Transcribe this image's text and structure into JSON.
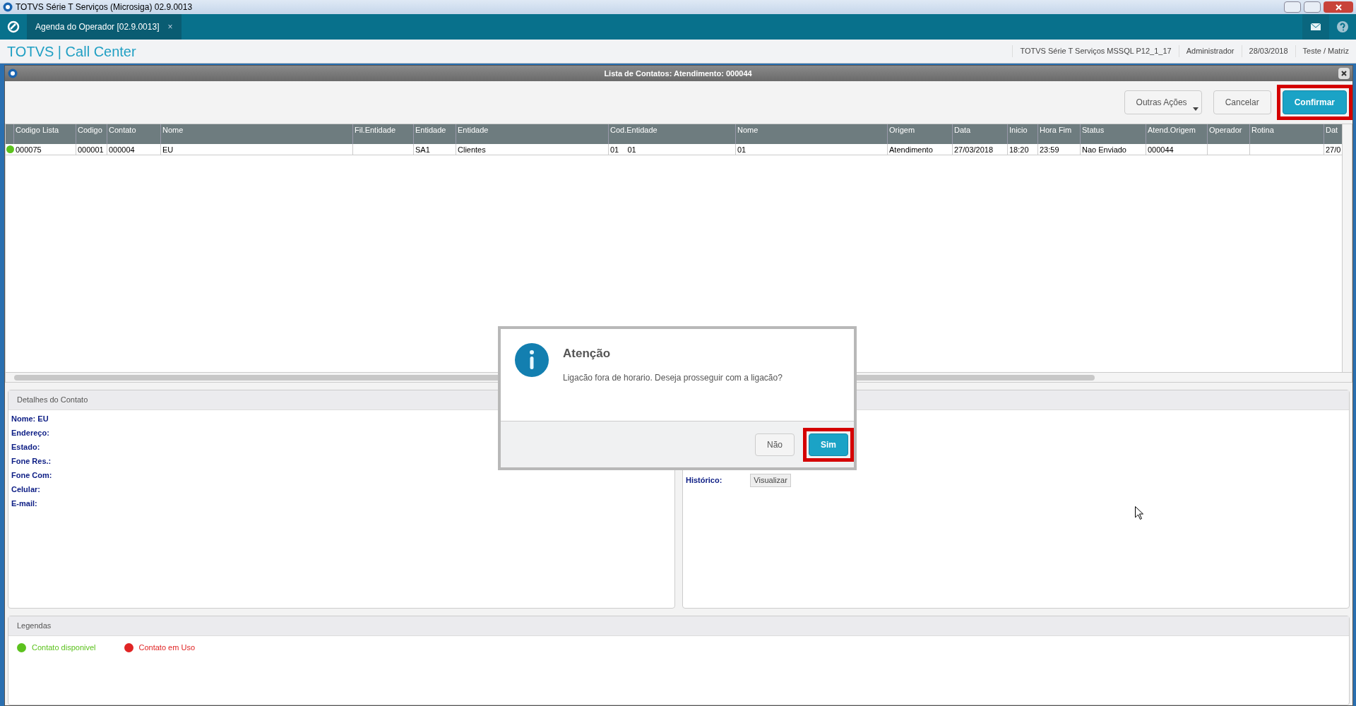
{
  "window": {
    "title": "TOTVS Série T Serviços (Microsiga) 02.9.0013"
  },
  "tabs": [
    {
      "label": "Agenda do Operador [02.9.0013]",
      "selected": true,
      "close": "×"
    }
  ],
  "header": {
    "brand": "TOTVS | Call Center",
    "info": [
      "TOTVS Série T Serviços MSSQL P12_1_17",
      "Administrador",
      "28/03/2018",
      "Teste / Matriz"
    ]
  },
  "dialog": {
    "title": "Lista de Contatos: Atendimento: 000044",
    "toolbar": [
      {
        "label": "Outras Ações",
        "kind": "menu",
        "highlighted": false
      },
      {
        "label": "Cancelar",
        "kind": "plain",
        "highlighted": false
      },
      {
        "label": "Confirmar",
        "kind": "primary",
        "highlighted": true
      }
    ],
    "table": {
      "columns": [
        "Codigo Lista",
        "Codigo",
        "Contato",
        "Nome",
        "Fil.Entidade",
        "Entidade",
        "Entidade",
        "Cod.Entidade",
        "Nome",
        "Origem",
        "Data",
        "Inicio",
        "Hora Fim",
        "Status",
        "Atend.Origem",
        "Operador",
        "Rotina",
        "Dat"
      ],
      "rows": [
        {
          "color": "#5cc21e",
          "cells": [
            "000075",
            "000001",
            "000004",
            "EU",
            "",
            "SA1",
            "Clientes",
            "01    01",
            "01",
            "Atendimento",
            "27/03/2018",
            "18:20",
            "23:59",
            "Nao Enviado",
            "000044",
            "",
            "",
            "27/0"
          ]
        }
      ]
    },
    "details": {
      "title": "Detalhes do Contato",
      "fields": [
        {
          "label": "Nome:",
          "value": "EU"
        },
        {
          "label": "Endereço:"
        },
        {
          "label": "Estado:"
        },
        {
          "label": "Fone Res.:"
        },
        {
          "label": "Fone Com:"
        },
        {
          "label": "Celular:"
        },
        {
          "label": "E-mail:"
        }
      ]
    },
    "history": {
      "label": "Histórico:",
      "button": "Visualizar"
    },
    "legend": {
      "title": "Legendas",
      "items": [
        {
          "label": "Contato disponivel",
          "color": "#5cc21e"
        },
        {
          "label": "Contato em Uso",
          "color": "#e02424"
        }
      ]
    }
  },
  "alert": {
    "title": "Atenção",
    "message": "Ligacão fora de horario. Deseja prosseguir com a ligacão?",
    "buttons": [
      {
        "label": "Não",
        "kind": "plain",
        "highlighted": false
      },
      {
        "label": "Sim",
        "kind": "primary",
        "highlighted": true
      }
    ]
  }
}
